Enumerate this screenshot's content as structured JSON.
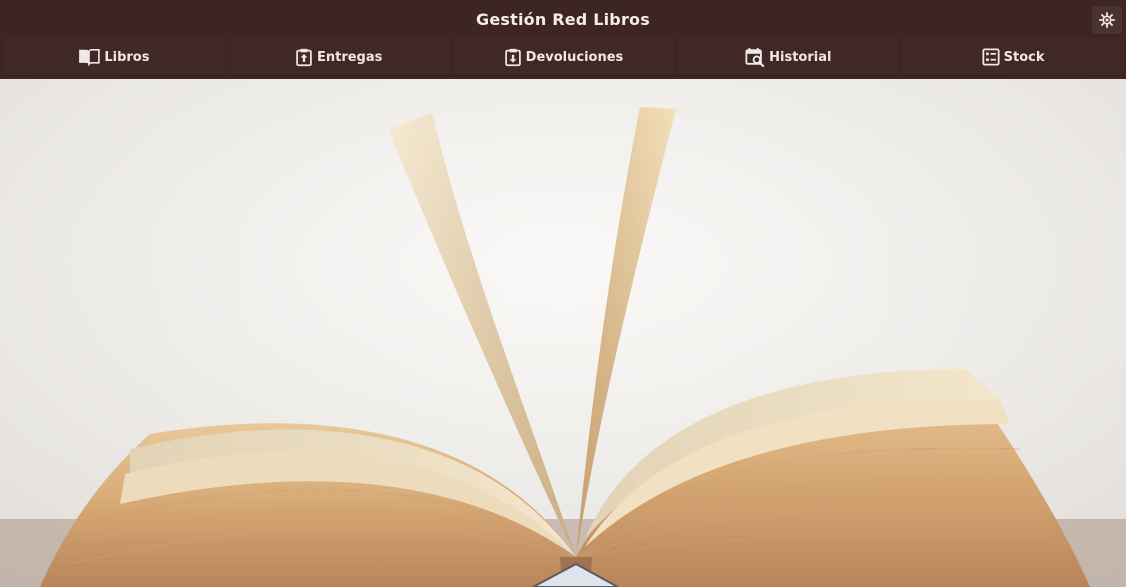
{
  "app": {
    "title": "Gestión Red Libros"
  },
  "header": {
    "settings_icon": "gear-sun-icon"
  },
  "tabs": [
    {
      "label": "Libros",
      "icon": "book-open-icon"
    },
    {
      "label": "Entregas",
      "icon": "upload-box-icon"
    },
    {
      "label": "Devoluciones",
      "icon": "download-box-icon"
    },
    {
      "label": "Historial",
      "icon": "calendar-search-icon"
    },
    {
      "label": "Stock",
      "icon": "list-box-icon"
    }
  ],
  "hero": {
    "subject": "open-book-photo"
  },
  "colors": {
    "header_bg": "#3c2523",
    "tab_bg": "#3f2826",
    "text": "#f0e8e6"
  }
}
